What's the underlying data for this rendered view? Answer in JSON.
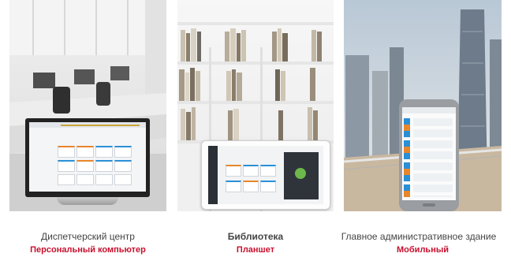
{
  "panels": [
    {
      "location": "Диспетчерский центр",
      "device": "Персональный компьютер"
    },
    {
      "location": "Библиотека",
      "device": "Планшет"
    },
    {
      "location": "Главное административное здание",
      "device": "Мобильный"
    }
  ],
  "colors": {
    "accent": "#c8102e",
    "caption": "#444444"
  }
}
